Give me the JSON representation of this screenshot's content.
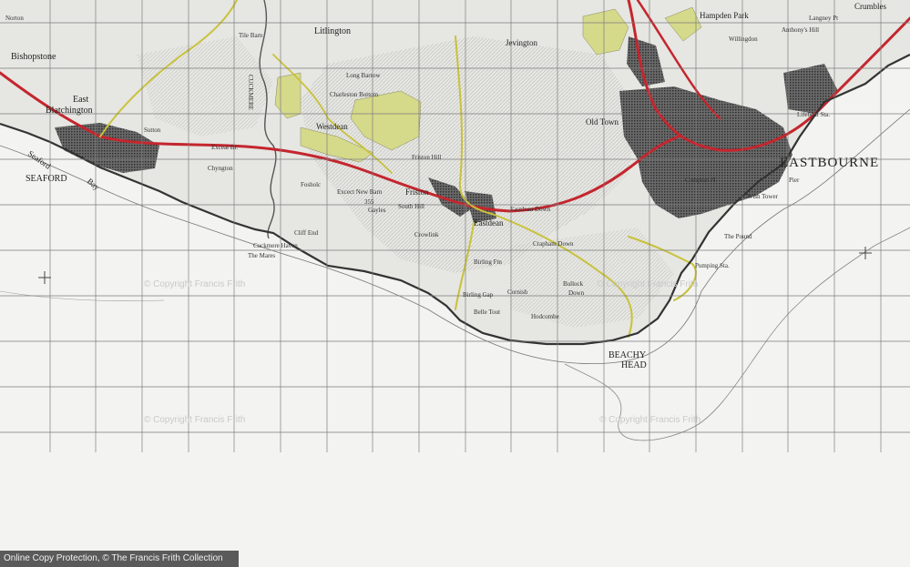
{
  "map": {
    "places": {
      "eastbourne": "EASTBOURNE",
      "seaford": "SEAFORD",
      "beachy_head_1": "BEACHY",
      "beachy_head_2": "HEAD",
      "east_blatchington_1": "East",
      "east_blatchington_2": "Blatchington",
      "bishopstone": "Bishopstone",
      "litlington": "Litlington",
      "westdean": "Westdean",
      "friston": "Friston",
      "eastdean": "Eastdean",
      "jevington": "Jevington",
      "old_town": "Old Town",
      "hampden_park": "Hampden Park",
      "willingdon": "Willingdon",
      "seaford_bay_1": "Seaford",
      "seaford_bay_2": "Bay",
      "cuckmere_haven": "Cuckmere Haven",
      "the_mares": "The Mares",
      "birling_gap": "Birling Gap",
      "crowlink": "Crowlink",
      "wish_tower": "Wish Tower",
      "the_pound": "The Pound",
      "pumping_sta": "Pumping Sta.",
      "lifeboat_sta": "Lifeboat Sta.",
      "pier": "Pier",
      "bullock_down_1": "Bullock",
      "bullock_down_2": "Down",
      "cliff_end": "Cliff End",
      "exceat_br": "Exceat Br.",
      "excect_new_barn": "Excect New Barn",
      "fosholc": "Fosholc",
      "gayles": "Gayles",
      "south_hill": "South Hill",
      "tile_barn": "Tile Barn",
      "norton": "Norton",
      "sutton": "Sutton",
      "chyngton": "Chyngton",
      "eastdean_down": "Eastdean Down",
      "friston_hill": "Friston Hill",
      "charleston_bottom": "Charleston Bottom",
      "long_barrow": "Long Barrow",
      "hodcombe": "Hodcombe",
      "cornish": "Cornish",
      "crapham_down": "Crapham Down",
      "belle_tout": "Belle Tout",
      "birling_fm": "Birling Fm",
      "anthonys_hill": "Anthony's Hill",
      "langney_pt": "Langney Pt",
      "crumbles": "Crumbles",
      "cuckmere": "CUCKMERE",
      "hill_g": "Hill",
      "compton_pl": "Compton Pl"
    },
    "spot_height": "355",
    "watermarks": [
      "© Copyright Francis Frith",
      "© Copyright Francis Frith",
      "© Copyright Francis Frith"
    ]
  },
  "footer": {
    "text": "Online Copy Protection,  © The Francis Frith Collection"
  },
  "colors": {
    "land": "#e7e7e4",
    "sea": "#f3f3f1",
    "grid": "#7d7d7d",
    "road_a": "#c4262e",
    "road_b": "#c8c23a",
    "woodland": "#d6d98a",
    "town": "#4a4a4a"
  }
}
